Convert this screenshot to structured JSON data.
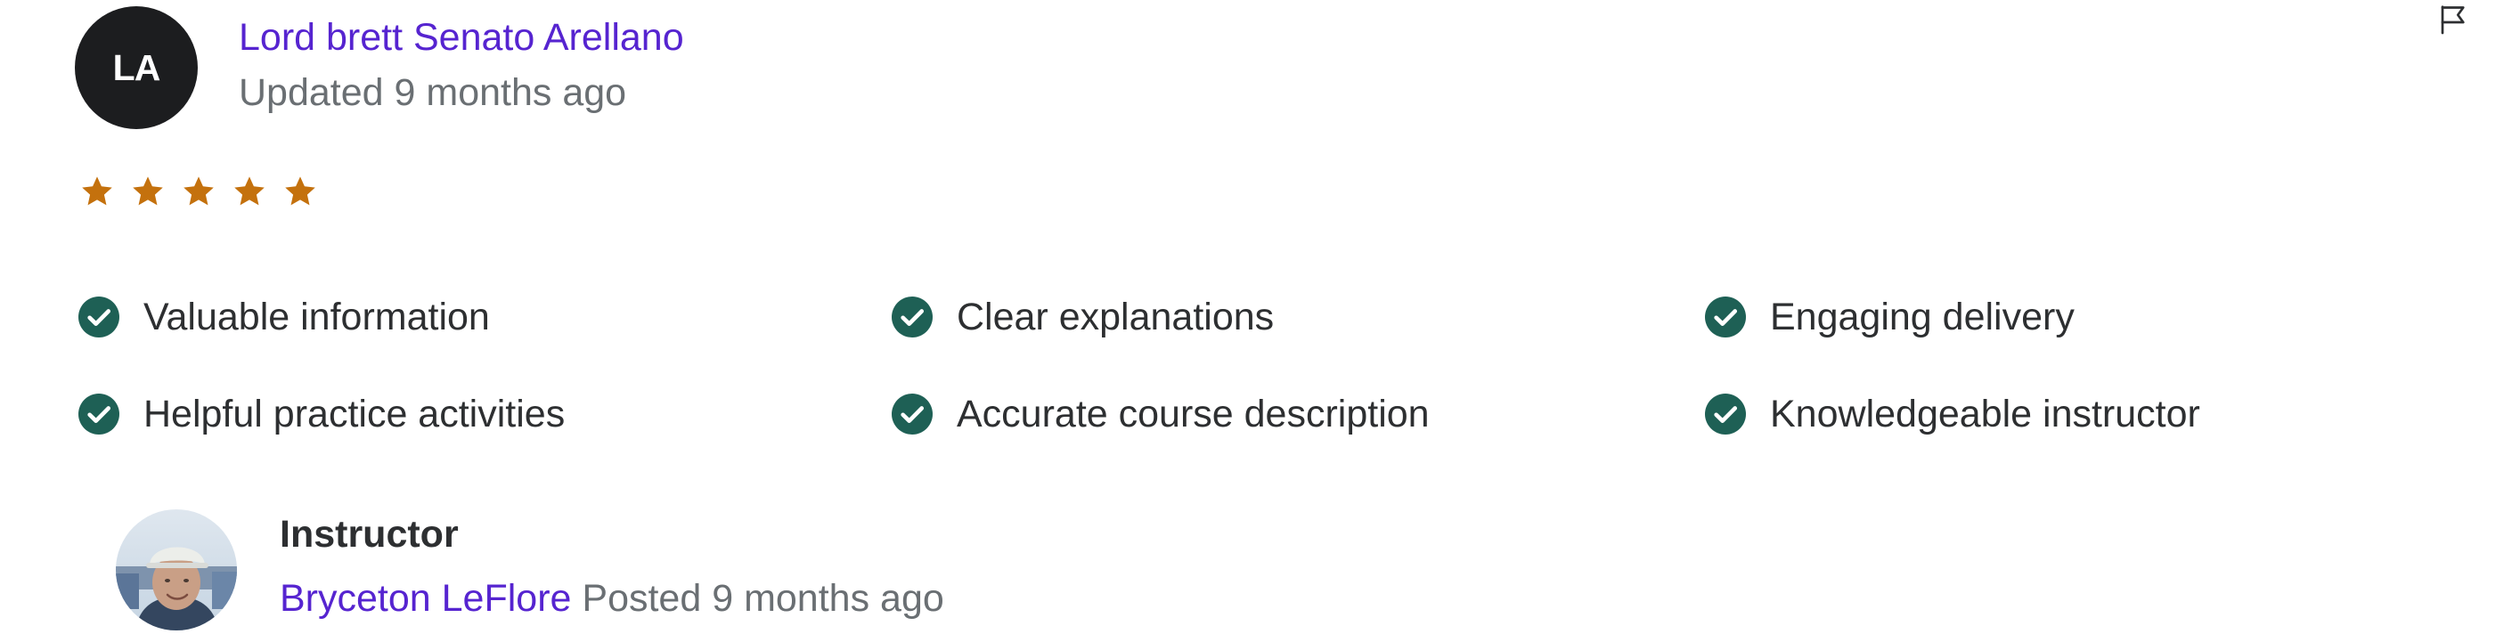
{
  "review": {
    "reviewer_initials": "LA",
    "reviewer_name": "Lord brett Senato Arellano",
    "updated_text": "Updated 9 months ago",
    "rating": 5,
    "rating_max": 5
  },
  "tags": [
    "Valuable information",
    "Clear explanations",
    "Engaging delivery",
    "Helpful practice activities",
    "Accurate course description",
    "Knowledgeable instructor"
  ],
  "instructor_response": {
    "heading": "Instructor",
    "name": "Bryceton LeFlore",
    "posted_text": "Posted 9 months ago"
  },
  "colors": {
    "link": "#5624d0",
    "star": "#c4710d",
    "check": "#1e6055",
    "avatar_bg": "#1c1d1f",
    "muted_text": "#6a6f73"
  },
  "icons": {
    "flag": "flag-icon",
    "star": "star-icon",
    "check": "check-circle-icon"
  }
}
